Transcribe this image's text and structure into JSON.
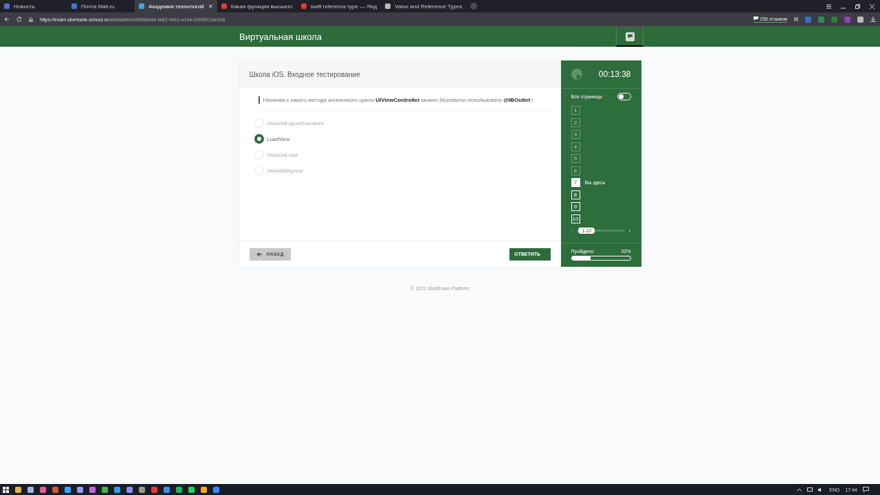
{
  "browser": {
    "tabs": [
      {
        "title": "Новость",
        "selected": false
      },
      {
        "title": "Почта Mail.ru",
        "selected": false
      },
      {
        "title": "Академия технологий",
        "selected": true,
        "close": "✕"
      },
      {
        "title": "Какая функция высшего",
        "selected": false
      },
      {
        "title": "swift reference type — Янд",
        "selected": false
      },
      {
        "title": "Value and Reference Types",
        "selected": false
      }
    ],
    "url_host": "https://exam.sberbank-school.ru",
    "url_path": "/atdata#test/eb89ba9e-fa63-4b63-a1a4-02b6811de3c8",
    "reviews": "158 отзывов"
  },
  "header": {
    "logo": "Виртуальная школа"
  },
  "test": {
    "title": "Школа iOS. Входное тестирование",
    "question": "Начиная с какого метода жизненного цикла **UIViewController** можно безопасно использовать **@IBOutlet**?",
    "options": [
      {
        "label": "ViewDidLayoutSubviews",
        "selected": false
      },
      {
        "label": "LoadView",
        "selected": true
      },
      {
        "label": "ViewDidLoad",
        "selected": false
      },
      {
        "label": "ViewWillAppear",
        "selected": false
      }
    ],
    "buttons": [
      {
        "label": "НАЗАД",
        "kind": "back",
        "disabled": true
      },
      {
        "label": "ОТВЕТИТЬ",
        "kind": "forward",
        "disabled": false
      }
    ]
  },
  "sidebar": {
    "timer": "00:13:38",
    "all_pages_label": "Все страницы",
    "all_pages_on": false,
    "pages": [
      {
        "label": "1",
        "visited": true,
        "selected": false
      },
      {
        "label": "2",
        "visited": true,
        "selected": false
      },
      {
        "label": "3",
        "visited": true,
        "selected": false
      },
      {
        "label": "4",
        "visited": true,
        "selected": false
      },
      {
        "label": "5",
        "visited": true,
        "selected": false
      },
      {
        "label": "6",
        "visited": true,
        "selected": false
      },
      {
        "label": "7",
        "visited": false,
        "selected": true,
        "note": "Вы здесь"
      },
      {
        "label": "8",
        "visited": false,
        "selected": false
      },
      {
        "label": "9",
        "visited": false,
        "selected": false
      },
      {
        "label": "10",
        "visited": false,
        "selected": false
      }
    ],
    "pager": {
      "label": "1-10",
      "prev": "‹",
      "next": "›"
    },
    "progress_label": "Пройдено:",
    "progress_value": "32%",
    "level": 0.32
  },
  "footer": "© 2021 StartExam Platform",
  "taskbar": {
    "lang": "ENG",
    "time": "17:44"
  }
}
